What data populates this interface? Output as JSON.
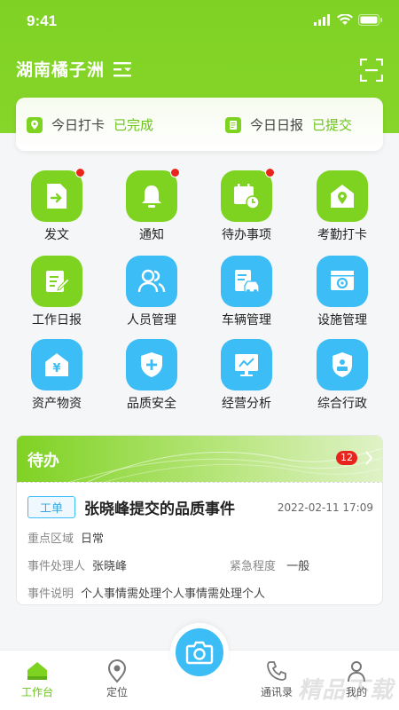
{
  "status_bar": {
    "time": "9:41"
  },
  "header": {
    "title": "湖南橘子洲"
  },
  "checkin": {
    "punch_label": "今日打卡",
    "punch_status": "已完成",
    "report_label": "今日日报",
    "report_status": "已提交"
  },
  "grid": [
    {
      "label": "发文",
      "color": "green",
      "icon": "document-send-icon",
      "badge": true
    },
    {
      "label": "通知",
      "color": "green",
      "icon": "bell-icon",
      "badge": true
    },
    {
      "label": "待办事项",
      "color": "green",
      "icon": "calendar-clock-icon",
      "badge": true
    },
    {
      "label": "考勤打卡",
      "color": "green",
      "icon": "location-house-icon",
      "badge": false
    },
    {
      "label": "工作日报",
      "color": "green",
      "icon": "edit-report-icon",
      "badge": false
    },
    {
      "label": "人员管理",
      "color": "blue",
      "icon": "people-icon",
      "badge": false
    },
    {
      "label": "车辆管理",
      "color": "blue",
      "icon": "car-icon",
      "badge": false
    },
    {
      "label": "设施管理",
      "color": "blue",
      "icon": "gear-window-icon",
      "badge": false
    },
    {
      "label": "资产物资",
      "color": "blue",
      "icon": "asset-house-icon",
      "badge": false
    },
    {
      "label": "品质安全",
      "color": "blue",
      "icon": "shield-plus-icon",
      "badge": false
    },
    {
      "label": "经营分析",
      "color": "blue",
      "icon": "chart-monitor-icon",
      "badge": false
    },
    {
      "label": "综合行政",
      "color": "blue",
      "icon": "badge-stamp-icon",
      "badge": false
    }
  ],
  "todo": {
    "title": "待办",
    "count": "12",
    "item": {
      "tag": "工单",
      "subject": "张晓峰提交的品质事件",
      "time": "2022-02-11 17:09",
      "area_label": "重点区域",
      "area_value": "日常",
      "handler_label": "事件处理人",
      "handler_value": "张晓峰",
      "urgency_label": "紧急程度",
      "urgency_value": "一般",
      "desc_label": "事件说明",
      "desc_value": "个人事情需处理个人事情需处理个人"
    }
  },
  "tabbar": [
    {
      "label": "工作台",
      "icon": "home-icon",
      "active": true
    },
    {
      "label": "定位",
      "icon": "location-pin-icon",
      "active": false
    },
    {
      "label": "通讯录",
      "icon": "phone-icon",
      "active": false
    },
    {
      "label": "我的",
      "icon": "user-icon",
      "active": false
    }
  ],
  "camera": {
    "icon": "camera-icon"
  },
  "colors": {
    "primary_green": "#7ed321",
    "accent_blue": "#3dbdf5",
    "badge_red": "#e8241c"
  },
  "watermark": "精品下载"
}
